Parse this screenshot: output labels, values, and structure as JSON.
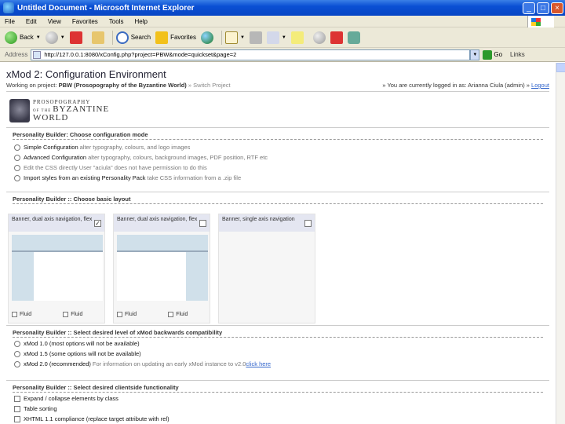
{
  "window": {
    "title": "Untitled Document - Microsoft Internet Explorer",
    "buttons": {
      "minimize": "_",
      "maximize": "□",
      "close": "×"
    }
  },
  "menu": [
    "File",
    "Edit",
    "View",
    "Favorites",
    "Tools",
    "Help"
  ],
  "toolbar": {
    "back": "Back",
    "search": "Search",
    "favorites": "Favorites"
  },
  "address": {
    "label": "Address",
    "url": "http://127.0.0.1:8080/xConfig.php?project=PBW&mode=quickset&page=2",
    "go": "Go",
    "links": "Links"
  },
  "page": {
    "title": "xMod 2: Configuration Environment",
    "project_prefix": "Working on project:",
    "project_name": "PBW (Prosopography of the Byzantine World)",
    "switch": "» Switch Project",
    "logged_in": "» You are currently logged in as: Arianna Ciula (admin) »",
    "logout": "Logout",
    "logo": {
      "line1": "PROSOPOGRAPHY",
      "line2_small": "OF THE",
      "line2": "BYZANTINE",
      "line3": "WORLD"
    },
    "mode": {
      "heading": "Personality Builder: Choose configuration mode",
      "options": [
        {
          "main": "Simple Configuration",
          "desc": "alter typography, colours, and logo images",
          "disabled": false
        },
        {
          "main": "Advanced Configuration",
          "desc": "alter typography, colours, background images, PDF position, RTF etc",
          "disabled": false
        },
        {
          "main": "Edit the CSS directly",
          "desc": "User \"aciula\" does not have permission to do this",
          "disabled": true
        },
        {
          "main": "Import styles from an existing Personality Pack",
          "desc": "take CSS information from a .zip file",
          "disabled": false
        }
      ]
    },
    "layout": {
      "heading": "Personality Builder :: Choose basic layout",
      "cards": [
        {
          "title": "Banner, dual axis navigation, flex",
          "checked": true,
          "foot": [
            "Fluid",
            "Fluid"
          ]
        },
        {
          "title": "Banner, dual axis navigation, flex",
          "checked": false,
          "foot": [
            "Fluid",
            "Fluid"
          ]
        },
        {
          "title": "Banner, single axis navigation",
          "checked": false,
          "foot": []
        }
      ],
      "check_mark": "✓"
    },
    "compat": {
      "heading": "Personality Builder :: Select desired level of xMod backwards compatibility",
      "options": [
        {
          "main": "xMod 1.0 (most options will not be available)",
          "desc": ""
        },
        {
          "main": "xMod 1.5 (some options will not be available)",
          "desc": ""
        },
        {
          "main": "xMod 2.0 (recommended)",
          "desc": "For information on updating an early xMod instance to v2.0",
          "link": "click here"
        }
      ]
    },
    "client": {
      "heading": "Personality Builder :: Select desired clientside functionality",
      "options": [
        {
          "main": "Expand / collapse elements by class"
        },
        {
          "main": "Table sorting"
        },
        {
          "main": "XHTML 1.1 compliance (replace target attribute with rel)"
        }
      ]
    }
  },
  "colors": {
    "titlebar": "#0a4fd4",
    "chrome": "#ece9d8",
    "preview_blue": "#d0e0ea"
  }
}
